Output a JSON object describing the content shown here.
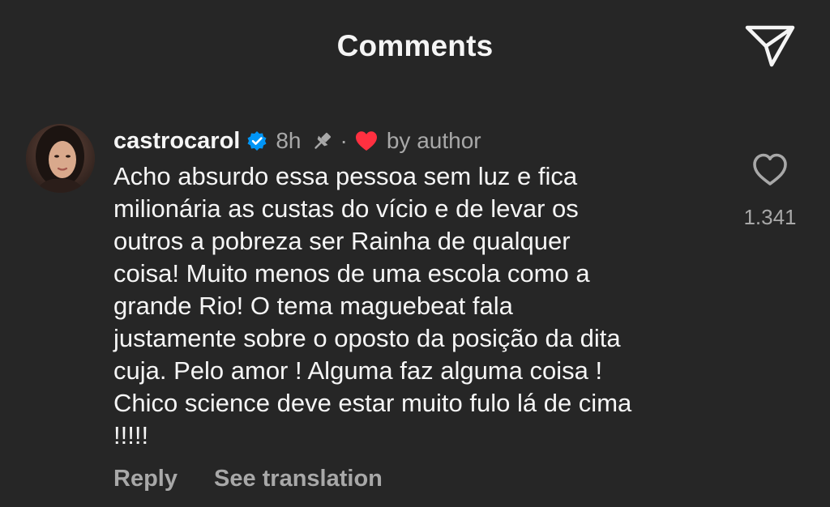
{
  "header": {
    "title": "Comments",
    "send_icon": "paper-plane-icon"
  },
  "comment": {
    "avatar_icon": "user-avatar",
    "username": "castrocarol",
    "verified_icon": "verified-badge-icon",
    "timestamp": "8h",
    "pin_icon": "pin-icon",
    "separator": "·",
    "author_like_icon": "red-heart-icon",
    "author_like_label": "by author",
    "text": "Acho absurdo essa pessoa sem luz e fica\nmilionária as custas do vício e de levar os\noutros a pobreza ser Rainha de qualquer\ncoisa! Muito menos de uma escola como a\ngrande Rio! O tema maguebeat fala\njustamente sobre o oposto da posição da dita\ncuja. Pelo amor ! Alguma faz alguma coisa !\nChico science deve estar muito fulo lá de cima\n!!!!!",
    "like_icon": "heart-outline-icon",
    "like_count": "1.341",
    "reply_label": "Reply",
    "translate_label": "See translation"
  },
  "colors": {
    "background": "#262626",
    "primary_text": "#f5f5f5",
    "secondary_text": "#a8a8a8",
    "verified_blue": "#0095f6",
    "heart_red": "#ff3040"
  }
}
